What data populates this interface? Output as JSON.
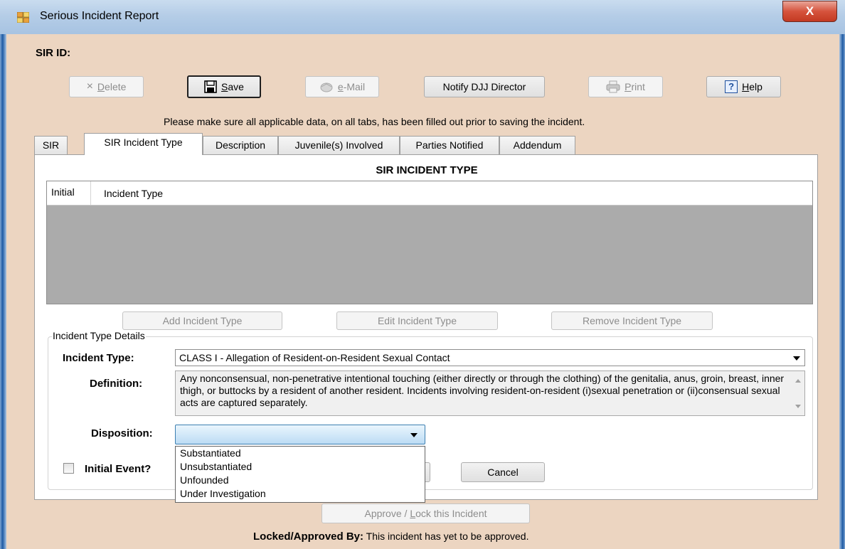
{
  "window": {
    "title": "Serious Incident Report",
    "close_label": "X"
  },
  "header": {
    "sir_id_label": "SIR ID:",
    "note": "Please make sure all applicable data, on all tabs, has been filled out prior to saving the incident."
  },
  "toolbar": {
    "delete": {
      "icon": "×",
      "pre": "",
      "ul": "D",
      "post": "elete",
      "enabled": false
    },
    "save": {
      "pre": "",
      "ul": "S",
      "post": "ave",
      "enabled": true
    },
    "email": {
      "pre": "",
      "ul": "e",
      "post": "-Mail",
      "enabled": false
    },
    "notify": {
      "label": "Notify DJJ Director",
      "enabled": true
    },
    "print": {
      "pre": "",
      "ul": "P",
      "post": "rint",
      "enabled": false
    },
    "help": {
      "icon": "?",
      "pre": "",
      "ul": "H",
      "post": "elp",
      "enabled": true
    }
  },
  "tabs": [
    {
      "label": "SIR",
      "active": false
    },
    {
      "label": "SIR Incident Type",
      "active": true
    },
    {
      "label": "Description",
      "active": false
    },
    {
      "label": "Juvenile(s) Involved",
      "active": false
    },
    {
      "label": "Parties Notified",
      "active": false
    },
    {
      "label": "Addendum",
      "active": false
    }
  ],
  "incident_panel": {
    "title": "SIR INCIDENT TYPE",
    "grid": {
      "columns": [
        "Initial",
        "Incident Type"
      ],
      "rows": []
    },
    "buttons": {
      "add": "Add Incident Type",
      "edit": "Edit Incident Type",
      "remove": "Remove Incident Type"
    },
    "details": {
      "legend": "Incident Type Details",
      "incident_type_label": "Incident Type:",
      "incident_type_value": "CLASS I - Allegation of Resident-on-Resident Sexual Contact",
      "definition_label": "Definition:",
      "definition_text": "Any nonconsensual, non-penetrative intentional touching (either directly or through the clothing) of the genitalia, anus, groin, breast, inner thigh, or buttocks by a resident of another resident. Incidents involving resident-on-resident (i)sexual penetration or (ii)consensual sexual acts are captured separately.",
      "disposition_label": "Disposition:",
      "disposition_value": "",
      "disposition_options": [
        "Substantiated",
        "Unsubstantiated",
        "Unfounded",
        "Under Investigation"
      ],
      "initial_event_label": "Initial Event?",
      "initial_event_checked": false,
      "cancel": "Cancel"
    }
  },
  "footer": {
    "approve_pre": "Approve / ",
    "approve_ul": "L",
    "approve_post": "ock this Incident",
    "locked_label": "Locked/Approved By:",
    "locked_value": "This incident has yet to be approved."
  }
}
